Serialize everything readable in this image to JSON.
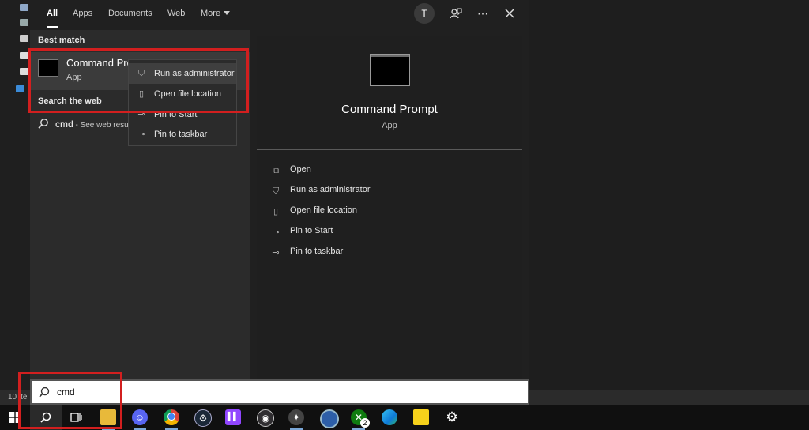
{
  "tabs": [
    {
      "label": "All"
    },
    {
      "label": "Apps"
    },
    {
      "label": "Documents"
    },
    {
      "label": "Web"
    },
    {
      "label": "More"
    }
  ],
  "account_initial": "T",
  "results": {
    "best_match_heading": "Best match",
    "best_match": {
      "title": "Command Prompt",
      "subtitle": "App"
    },
    "web_heading": "Search the web",
    "web_query": "cmd",
    "web_suffix": " - See web resu"
  },
  "context_menu": [
    {
      "label": "Run as administrator",
      "icon": "shield-icon"
    },
    {
      "label": "Open file location",
      "icon": "file-location-icon"
    },
    {
      "label": "Pin to Start",
      "icon": "pin-icon"
    },
    {
      "label": "Pin to taskbar",
      "icon": "pin-icon"
    }
  ],
  "preview": {
    "title": "Command Prompt",
    "subtitle": "App",
    "actions": [
      {
        "label": "Open",
        "icon": "open-icon"
      },
      {
        "label": "Run as administrator",
        "icon": "shield-icon"
      },
      {
        "label": "Open file location",
        "icon": "file-location-icon"
      },
      {
        "label": "Pin to Start",
        "icon": "pin-icon"
      },
      {
        "label": "Pin to taskbar",
        "icon": "pin-icon"
      }
    ]
  },
  "search": {
    "value": "cmd"
  },
  "desktop_status": "10 ite",
  "taskbar": [
    {
      "name": "windows-start",
      "icon": "windows-logo-icon"
    },
    {
      "name": "search",
      "icon": "search-icon"
    },
    {
      "name": "task-view",
      "icon": "task-view-icon"
    },
    {
      "name": "file-explorer",
      "icon": "folder-icon",
      "color": "#e8b93a"
    },
    {
      "name": "discord",
      "icon": "discord-icon",
      "color": "#5865f2"
    },
    {
      "name": "chrome",
      "icon": "chrome-icon",
      "color": "#db4437"
    },
    {
      "name": "steam",
      "icon": "steam-icon",
      "color": "#1b2838"
    },
    {
      "name": "twitch",
      "icon": "twitch-icon",
      "color": "#9146ff"
    },
    {
      "name": "obs",
      "icon": "obs-icon",
      "color": "#302e31"
    },
    {
      "name": "davinci",
      "icon": "davinci-icon",
      "color": "#444444"
    },
    {
      "name": "app-blue",
      "icon": "blue-circle-icon",
      "color": "#2d5fa8"
    },
    {
      "name": "xbox",
      "icon": "xbox-icon",
      "color": "#107c10",
      "badge": "2"
    },
    {
      "name": "edge",
      "icon": "edge-icon",
      "color": "#0f7bd8"
    },
    {
      "name": "sticky-notes",
      "icon": "sticky-note-icon",
      "color": "#f7d21b"
    },
    {
      "name": "settings",
      "icon": "gear-icon",
      "color": "#101010"
    }
  ]
}
